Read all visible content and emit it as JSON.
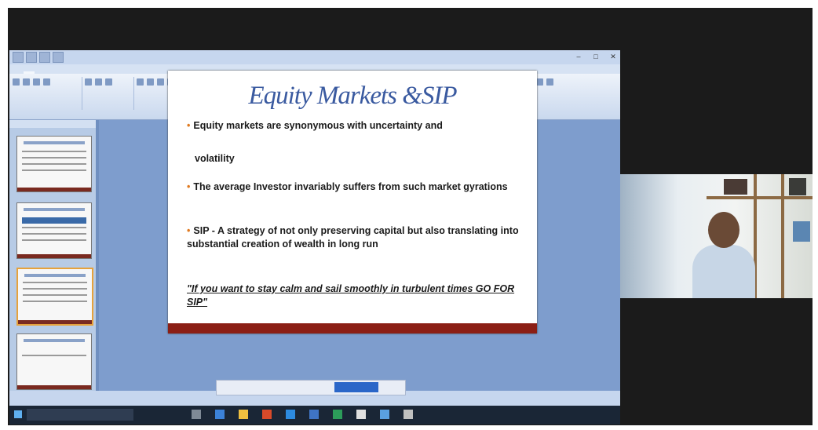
{
  "slide": {
    "title": "Equity Markets &SIP",
    "bullets": [
      "Equity markets are synonymous with uncertainty and",
      "volatility",
      "The average Investor invariably suffers from such market gyrations",
      "SIP - A strategy of not only preserving capital but also translating into substantial creation of wealth in long run"
    ],
    "quote": "\"If you want to stay calm and sail smoothly in turbulent times GO FOR SIP\""
  },
  "colors": {
    "title": "#3a5aa0",
    "bullet_marker": "#e07a20",
    "slide_footer": "#8b1e15",
    "frame_background": "#1b1b1b"
  },
  "icons": {
    "window_controls": [
      "minimize-icon",
      "maximize-icon",
      "close-icon"
    ],
    "taskbar": [
      "windows-start-icon",
      "search-icon"
    ]
  }
}
